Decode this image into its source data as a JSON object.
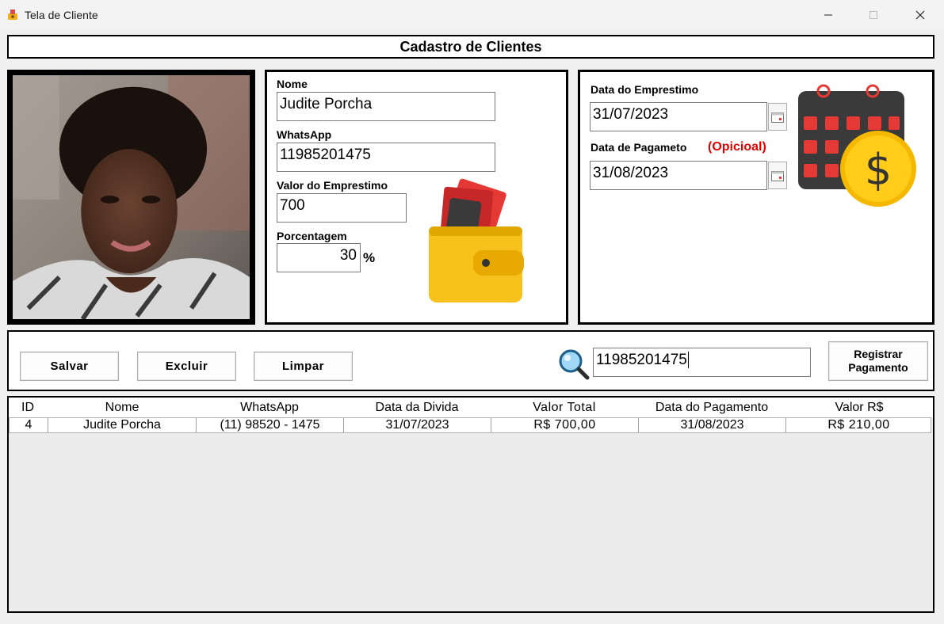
{
  "window": {
    "title": "Tela de Cliente"
  },
  "header": {
    "title": "Cadastro de Clientes"
  },
  "form": {
    "nome_label": "Nome",
    "nome_value": "Judite Porcha",
    "whatsapp_label": "WhatsApp",
    "whatsapp_value": "11985201475",
    "valor_label": "Valor do Emprestimo",
    "valor_value": "700",
    "porcentagem_label": "Porcentagem",
    "porcentagem_value": "30",
    "porcentagem_unit": "%"
  },
  "dates": {
    "emprestimo_label": "Data do Emprestimo",
    "emprestimo_value": "31/07/2023",
    "pagamento_label": "Data de Pagameto",
    "pagamento_optional": "(Opicioal)",
    "pagamento_value": "31/08/2023"
  },
  "actions": {
    "salvar": "Salvar",
    "excluir": "Excluir",
    "limpar": "Limpar",
    "search_value": "11985201475",
    "registrar_line1": "Registrar",
    "registrar_line2": "Pagamento"
  },
  "table": {
    "columns": [
      "ID",
      "Nome",
      "WhatsApp",
      "Data da Divida",
      "Valor Total",
      "Data do Pagamento",
      "Valor R$"
    ],
    "rows": [
      [
        "4",
        "Judite Porcha",
        "(11) 98520 - 1475",
        "31/07/2023",
        "R$ 700,00",
        "31/08/2023",
        "R$ 210,00"
      ]
    ]
  },
  "colors": {
    "optional_red": "#e00000",
    "coin_gold": "#f5b800",
    "calendar_red": "#e53935"
  },
  "icons": [
    "app-icon",
    "minimize-icon",
    "maximize-icon",
    "close-icon",
    "wallet-icon",
    "calendar-dollar-icon",
    "calendar-picker-icon",
    "search-icon"
  ]
}
